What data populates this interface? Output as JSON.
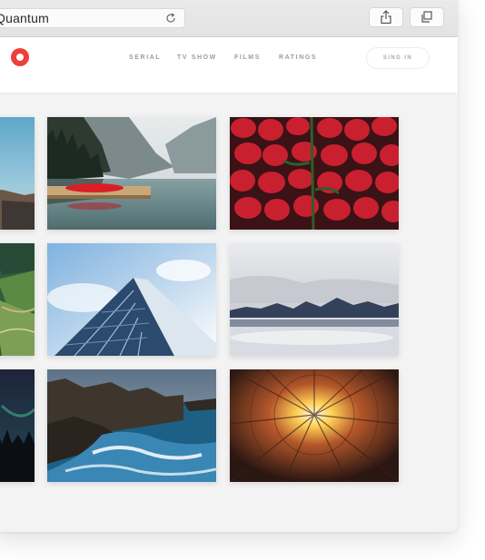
{
  "browser": {
    "address_text": "Quantum",
    "reload_icon": "reload-icon",
    "share_icon": "share-icon",
    "tabs_icon": "tabs-icon"
  },
  "site": {
    "logo": "circle-logo",
    "accent_color": "#ef3f3c",
    "nav": [
      "SERIAL",
      "TV SHOW",
      "FILMS",
      "RATINGS"
    ],
    "sign_in_label": "SING IN"
  },
  "gallery": [
    "lake-with-red-canoe-photo",
    "strawberries-photo",
    "glass-building-photo",
    "cloudy-mountain-lake-photo",
    "rocky-ocean-coast-photo",
    "courtyard-sun-photo",
    "partial-left-column-photos"
  ]
}
